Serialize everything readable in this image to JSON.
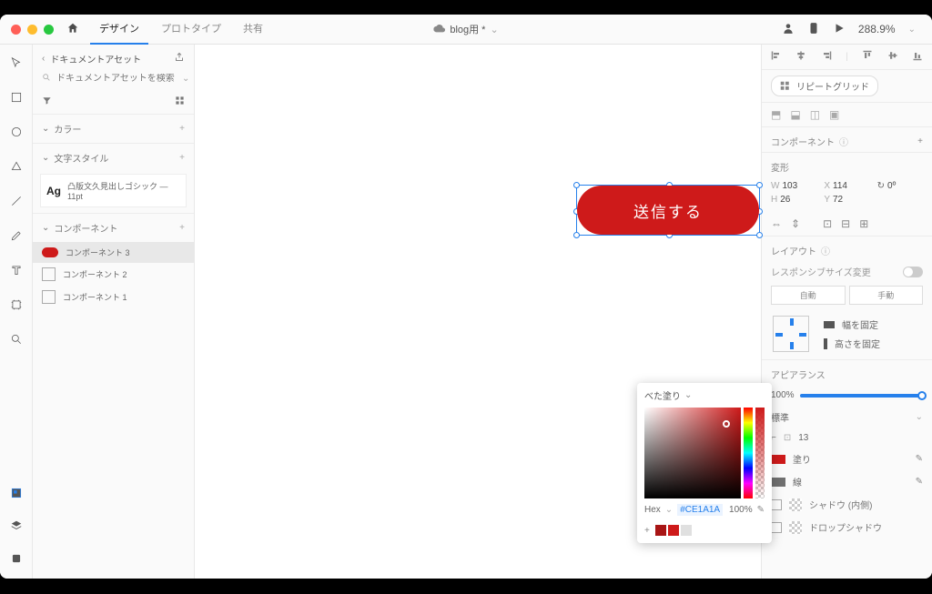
{
  "titlebar": {
    "menu": {
      "design": "デザイン",
      "prototype": "プロトタイプ",
      "share": "共有"
    },
    "doc": "blog用 *",
    "zoom": "288.9%"
  },
  "leftPanel": {
    "back": "ドキュメントアセット",
    "searchPlaceholder": "ドキュメントアセットを検索",
    "section_color": "カラー",
    "section_text": "文字スタイル",
    "textStyle": "凸版文久見出しゴシック — 11pt",
    "section_comp": "コンポーネント",
    "comp3": "コンポーネント 3",
    "comp2": "コンポーネント 2",
    "comp1": "コンポーネント 1"
  },
  "canvas": {
    "buttonLabel": "送信する",
    "buttonColor": "#CE1A1A"
  },
  "rightPanel": {
    "repeatGrid": "リピートグリッド",
    "component": "コンポーネント",
    "transform": "変形",
    "W": "103",
    "X": "114",
    "H": "26",
    "Y": "72",
    "angle": "0º",
    "layout": "レイアウト",
    "responsive": "レスポンシブサイズ変更",
    "auto": "自動",
    "manual": "手動",
    "fixW": "幅を固定",
    "fixH": "高さを固定",
    "appearance": "アピアランス",
    "opacity": "100%",
    "blend": "標準",
    "radius": "13",
    "fill": "塗り",
    "stroke": "線",
    "innerShadow": "シャドウ (内側)",
    "dropShadow": "ドロップシャドウ"
  },
  "picker": {
    "mode": "べた塗り",
    "hexLabel": "Hex",
    "hexValue": "#CE1A1A",
    "alpha": "100%"
  }
}
